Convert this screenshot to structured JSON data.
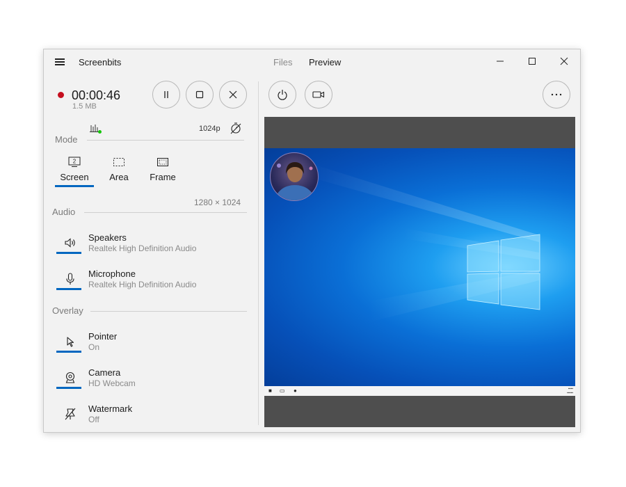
{
  "app": {
    "title": "Screenbits"
  },
  "nav": {
    "files": "Files",
    "preview": "Preview"
  },
  "recording": {
    "time": "00:00:46",
    "size": "1.5 MB",
    "status_color": "#c50f1f"
  },
  "status": {
    "resolution": "1024p"
  },
  "mode": {
    "label": "Mode",
    "options": [
      {
        "label": "Screen",
        "icon": "monitor-icon",
        "selected": true
      },
      {
        "label": "Area",
        "icon": "area-select-icon",
        "selected": false
      },
      {
        "label": "Frame",
        "icon": "frame-icon",
        "selected": false
      }
    ],
    "dimensions": "1280 × 1024",
    "screen_number": "2"
  },
  "audio": {
    "label": "Audio",
    "items": [
      {
        "name": "Speakers",
        "device": "Realtek High Definition Audio",
        "icon": "speaker-icon"
      },
      {
        "name": "Microphone",
        "device": "Realtek High Definition Audio",
        "icon": "microphone-icon"
      }
    ]
  },
  "overlay": {
    "label": "Overlay",
    "items": [
      {
        "name": "Pointer",
        "status": "On",
        "icon": "pointer-icon"
      },
      {
        "name": "Camera",
        "status": "HD Webcam",
        "icon": "webcam-icon"
      },
      {
        "name": "Watermark",
        "status": "Off",
        "icon": "watermark-off-icon"
      }
    ]
  },
  "colors": {
    "accent": "#0067c0",
    "level_indicator": "#16c60c"
  }
}
